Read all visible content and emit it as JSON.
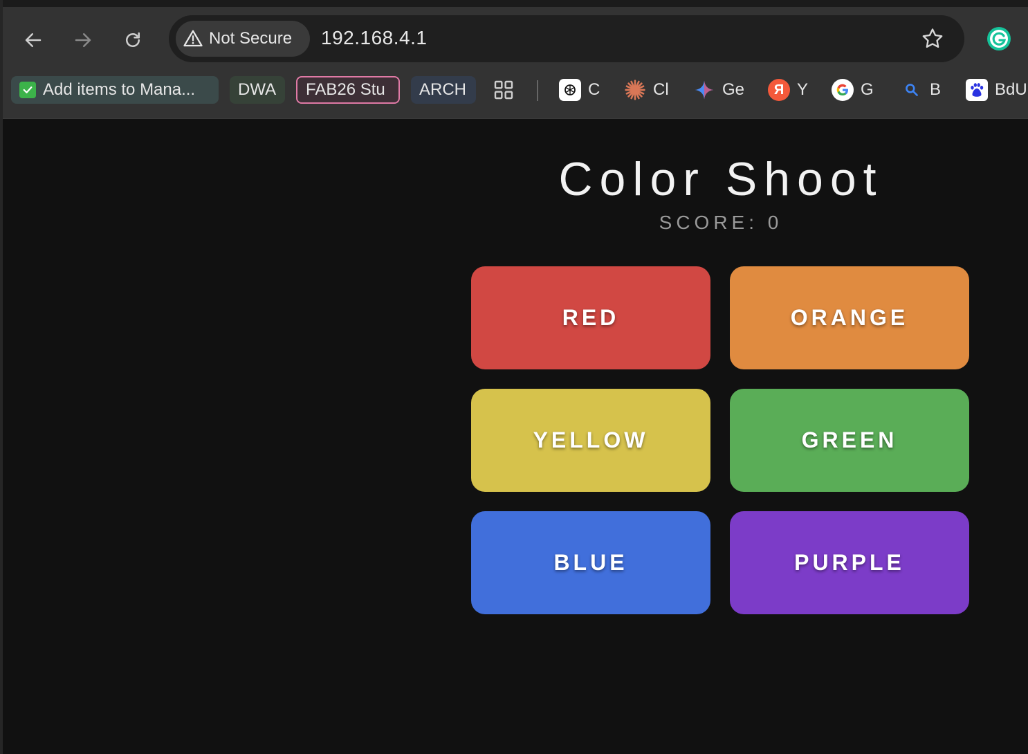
{
  "browser": {
    "security_label": "Not Secure",
    "url": "192.168.4.1",
    "bookmarks": [
      {
        "label": "Add items to Mana...",
        "icon": "check-box-icon"
      },
      {
        "label": "DWA"
      },
      {
        "label": "FAB26 Stu"
      },
      {
        "label": "ARCH"
      },
      {
        "label": "C",
        "icon": "chatgpt-icon"
      },
      {
        "label": "Cl",
        "icon": "claude-icon"
      },
      {
        "label": "Ge",
        "icon": "gemini-icon"
      },
      {
        "label": "Y",
        "icon": "yandex-icon"
      },
      {
        "label": "G",
        "icon": "google-icon"
      },
      {
        "label": "B",
        "icon": "search-icon"
      },
      {
        "label": "BdU",
        "icon": "baidu-icon"
      }
    ]
  },
  "game": {
    "title": "Color Shoot",
    "score_text": "SCORE: 0",
    "buttons": [
      {
        "label": "RED",
        "color": "#d14843"
      },
      {
        "label": "ORANGE",
        "color": "#e08b40"
      },
      {
        "label": "YELLOW",
        "color": "#d6c24c"
      },
      {
        "label": "GREEN",
        "color": "#5aad57"
      },
      {
        "label": "BLUE",
        "color": "#416fdb"
      },
      {
        "label": "PURPLE",
        "color": "#7c3cc8"
      }
    ]
  },
  "colors": {
    "toolbar": "#333333",
    "omnibox": "#1f1f1f",
    "page_background": "#111111"
  }
}
